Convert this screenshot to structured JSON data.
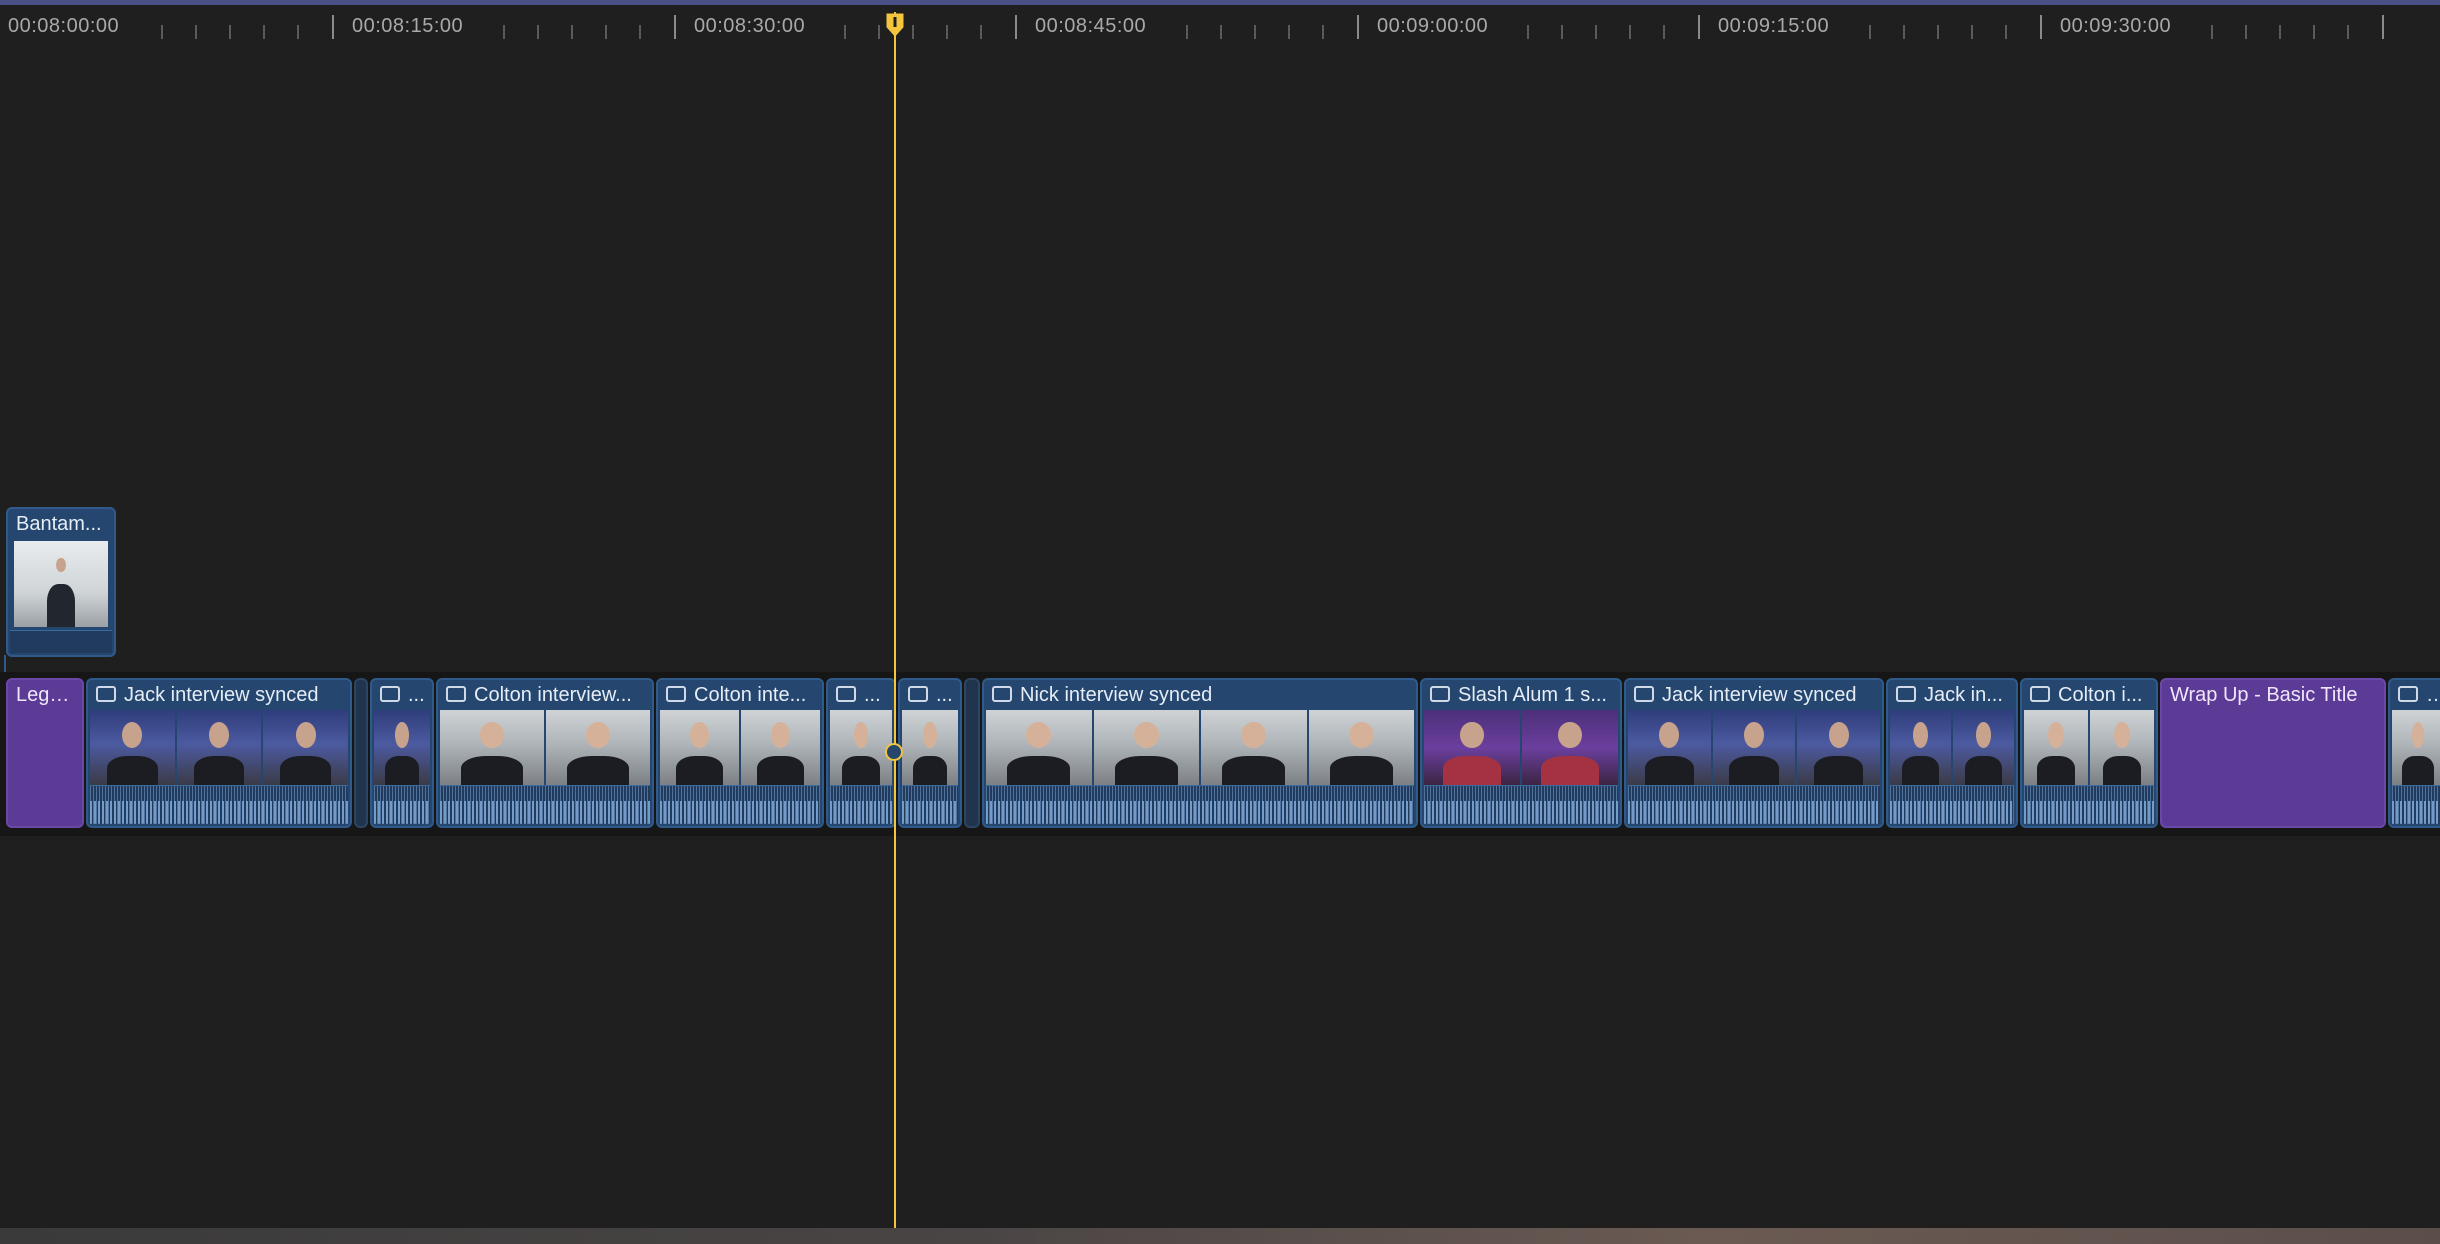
{
  "timeline": {
    "ruler_labels": [
      "00:08:00:00",
      "00:08:15:00",
      "00:08:30:00",
      "00:08:45:00",
      "00:09:00:00",
      "00:09:15:00",
      "00:09:30:00"
    ],
    "playhead_timecode_note": ""
  },
  "connected_clip": {
    "label": "Bantam..."
  },
  "clips": [
    {
      "label": "Lega...",
      "kind": "title"
    },
    {
      "label": "Jack interview synced",
      "kind": "video",
      "icon": "compound-clip-icon"
    },
    {
      "label": "...",
      "kind": "video",
      "icon": "compound-clip-icon"
    },
    {
      "label": "Colton interview...",
      "kind": "video",
      "icon": "link-icon"
    },
    {
      "label": "Colton inte...",
      "kind": "video",
      "icon": "link-icon"
    },
    {
      "label": "...",
      "kind": "video",
      "icon": "link-icon"
    },
    {
      "label": "...",
      "kind": "video",
      "icon": "link-icon"
    },
    {
      "label": "Nick interview synced",
      "kind": "video",
      "icon": "link-icon"
    },
    {
      "label": "Slash Alum 1 s...",
      "kind": "video",
      "icon": "compound-clip-icon"
    },
    {
      "label": "Jack interview synced",
      "kind": "video",
      "icon": "compound-clip-icon"
    },
    {
      "label": "Jack in...",
      "kind": "video",
      "icon": "compound-clip-icon"
    },
    {
      "label": "Colton i...",
      "kind": "video",
      "icon": "link-icon"
    },
    {
      "label": "Wrap Up - Basic Title",
      "kind": "title"
    },
    {
      "label": "Ni",
      "kind": "video"
    }
  ],
  "colors": {
    "playhead": "#f2c53d",
    "video_clip": "#24466f",
    "title_clip": "#5b3b96",
    "background": "#1f1f1f"
  }
}
